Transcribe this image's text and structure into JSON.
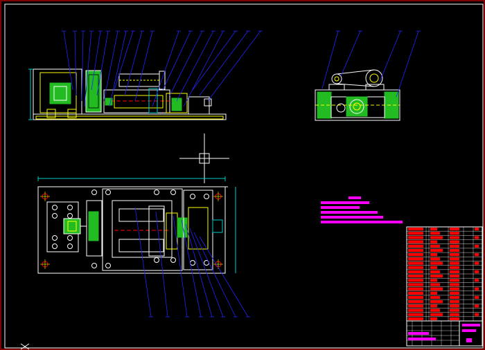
{
  "colors": {
    "background": "#000000",
    "frame": "#ff0000",
    "outline": "#ffffff",
    "part": "#ffff00",
    "leader": "#2222ff",
    "section": "#22bb22",
    "dimension": "#00cccc",
    "notes": "#ff00ff",
    "bom": "#ff0000",
    "cursor": "#ffffff"
  },
  "icons": {
    "cursor": "crosshair-cursor-icon",
    "ucs": "ucs-axis-icon"
  },
  "title_block": {
    "rows": 22,
    "columns": 6
  },
  "notes_lines": 6
}
